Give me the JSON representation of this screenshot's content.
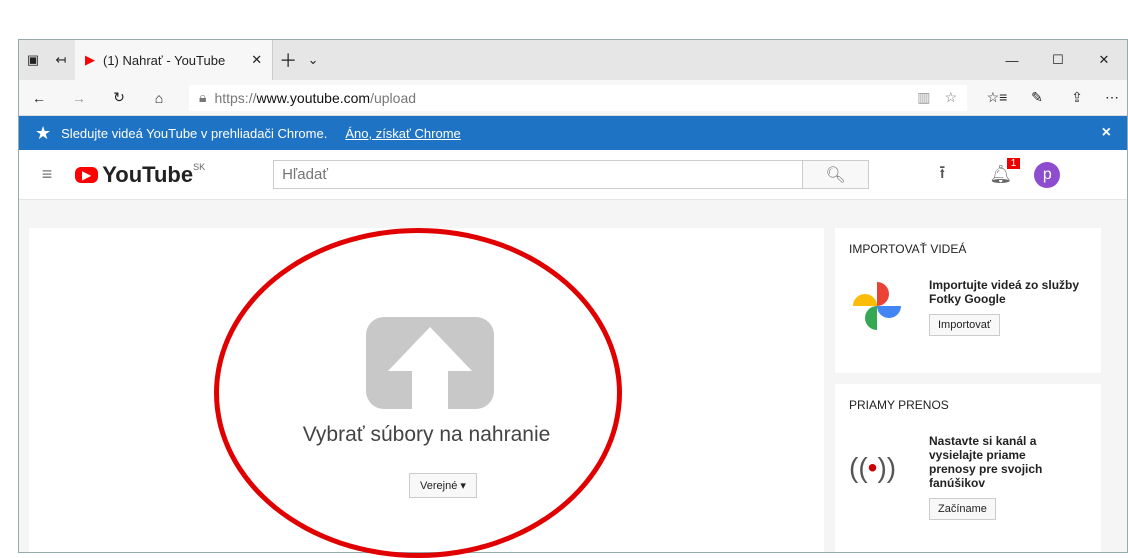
{
  "browser": {
    "tab_title": "(1) Nahrať - YouTube",
    "url_prefix": "https://",
    "url_host": "www.youtube.com",
    "url_path": "/upload"
  },
  "banner": {
    "text": "Sledujte videá YouTube v prehliadači Chrome.",
    "link": "Áno, získať Chrome",
    "close": "×"
  },
  "header": {
    "logo": "YouTube",
    "region": "SK",
    "search_placeholder": "Hľadať",
    "notifications": "1",
    "avatar": "p"
  },
  "upload": {
    "label": "Vybrať súbory na nahranie",
    "privacy": "Verejné"
  },
  "import": {
    "heading": "IMPORTOVAŤ VIDEÁ",
    "text": "Importujte videá zo služby Fotky Google",
    "button": "Importovať"
  },
  "live": {
    "heading": "PRIAMY PRENOS",
    "text": "Nastavte si kanál a vysielajte priame prenosy pre svojich fanúšikov",
    "button": "Začíname"
  },
  "colors": {
    "banner": "#1f73c4",
    "youtube_red": "#ff0000",
    "annotation": "#e00000"
  }
}
